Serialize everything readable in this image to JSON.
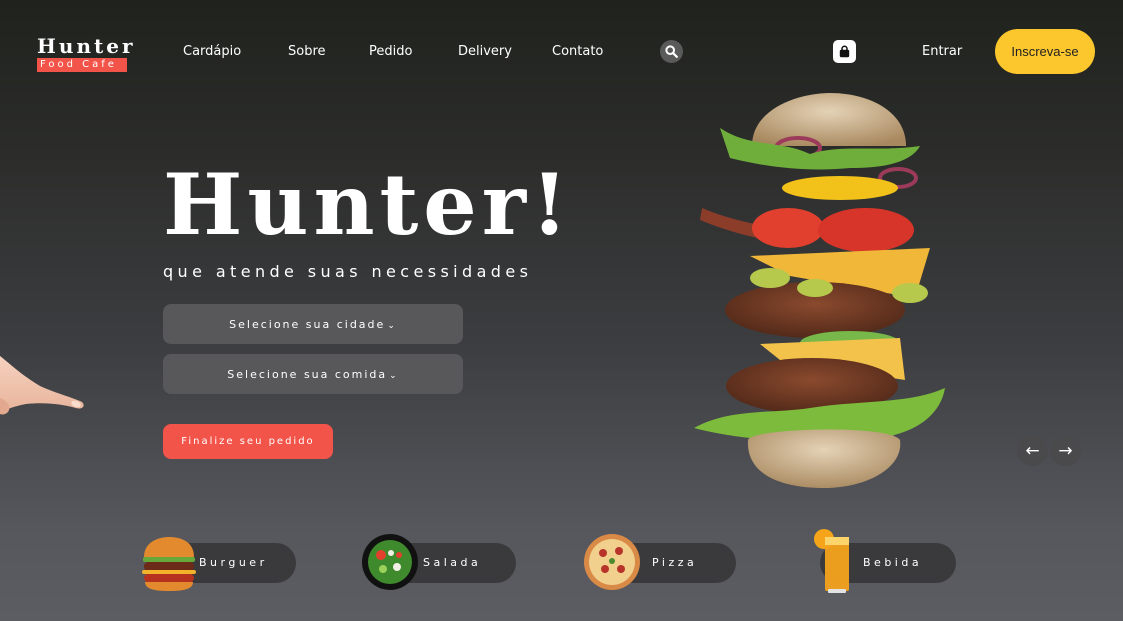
{
  "logo": {
    "title": "Hunter",
    "subtitle": "Food Cafe"
  },
  "nav": {
    "items": [
      "Cardápio",
      "Sobre",
      "Pedido",
      "Delivery",
      "Contato"
    ]
  },
  "header": {
    "search_icon": "search-icon",
    "cart_icon": "shopping-bag-icon",
    "login_label": "Entrar",
    "signup_label": "Inscreva-se"
  },
  "hero": {
    "title": "Hunter!",
    "subtitle": "que atende suas necessidades",
    "city_select": "Selecione sua cidade",
    "food_select": "Selecione sua comida",
    "order_button": "Finalize seu pedido",
    "prev_arrow": "←",
    "next_arrow": "→"
  },
  "categories": [
    {
      "label": "Burguer",
      "icon": "burger-icon"
    },
    {
      "label": "Salada",
      "icon": "salad-icon"
    },
    {
      "label": "Pizza",
      "icon": "pizza-icon"
    },
    {
      "label": "Bebida",
      "icon": "drink-icon"
    }
  ],
  "colors": {
    "accent": "#f2544a",
    "cta": "#fcc62d"
  }
}
